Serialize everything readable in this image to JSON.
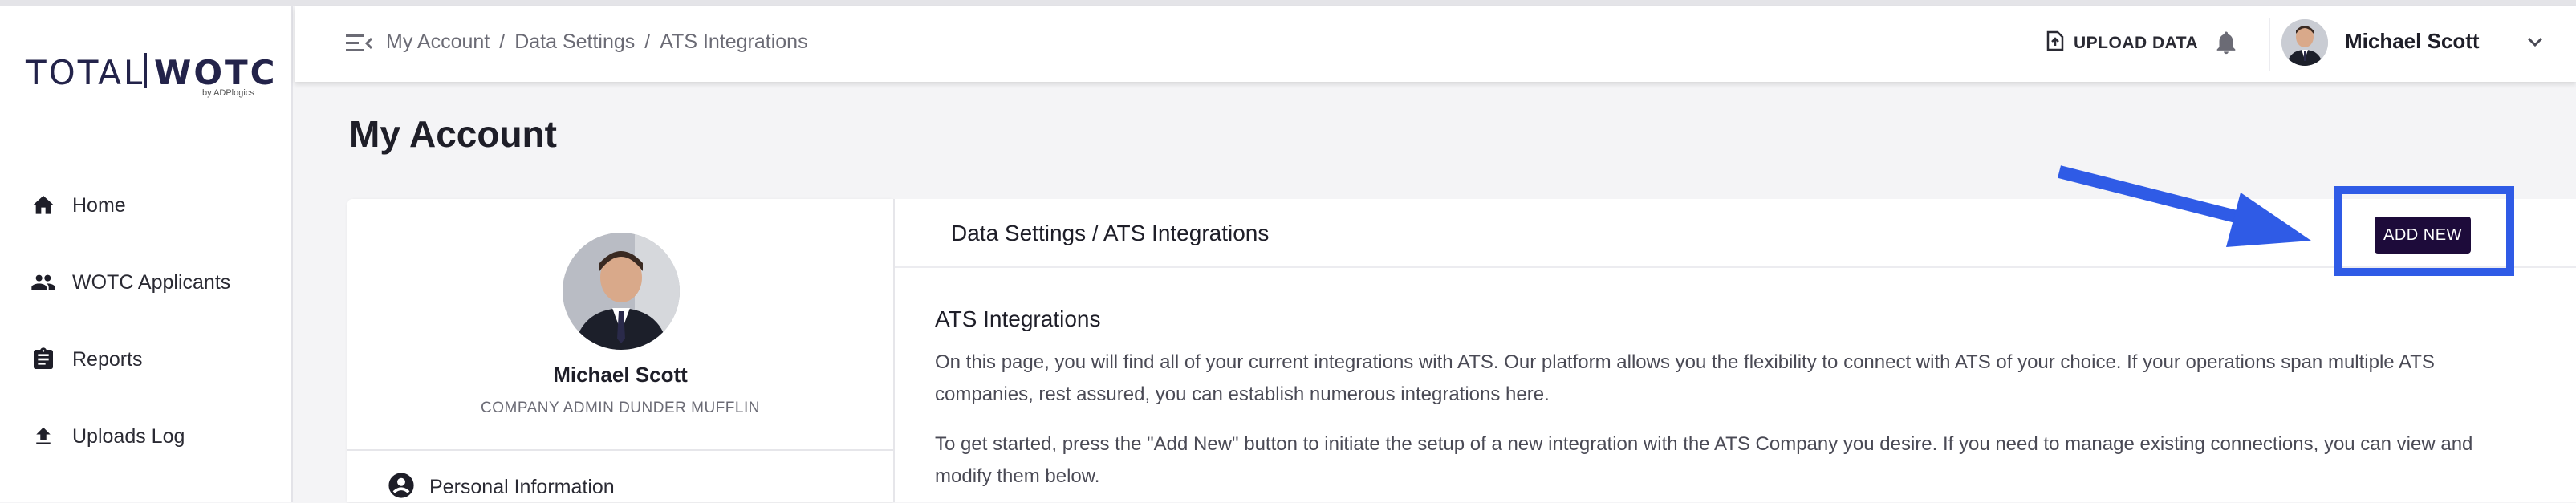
{
  "logo": {
    "left_word": "TOTAL",
    "right_word": "WOTC",
    "by_line": "by ADPlogics"
  },
  "sidebar": {
    "items": [
      {
        "label": "Home",
        "icon": "home-icon"
      },
      {
        "label": "WOTC Applicants",
        "icon": "people-icon"
      },
      {
        "label": "Reports",
        "icon": "clipboard-icon"
      },
      {
        "label": "Uploads Log",
        "icon": "upload-icon"
      }
    ]
  },
  "header": {
    "breadcrumb": [
      "My Account",
      "/",
      "Data Settings",
      "/",
      "ATS Integrations"
    ],
    "upload_label": "UPLOAD DATA",
    "user_name": "Michael Scott"
  },
  "page": {
    "title": "My Account"
  },
  "profile": {
    "name": "Michael Scott",
    "role": "COMPANY ADMIN DUNDER MUFFLIN",
    "menu_first": "Personal Information"
  },
  "content": {
    "header_title": "Data Settings / ATS Integrations",
    "add_button": "ADD NEW",
    "section_title": "ATS Integrations",
    "paragraph1": "On this page, you will find all of your current integrations with ATS. Our platform allows you the flexibility to connect with ATS of your choice. If your operations span multiple ATS companies, rest assured, you can establish numerous integrations here.",
    "paragraph2": "To get started, press the \"Add New\" button to initiate the setup of a new integration with the ATS Company you desire. If you need to manage existing connections, you can view and modify them below."
  },
  "colors": {
    "accent_button": "#1d0b3a",
    "highlight_annotation": "#2f5be6",
    "logo_orange": "#f07d2b"
  }
}
